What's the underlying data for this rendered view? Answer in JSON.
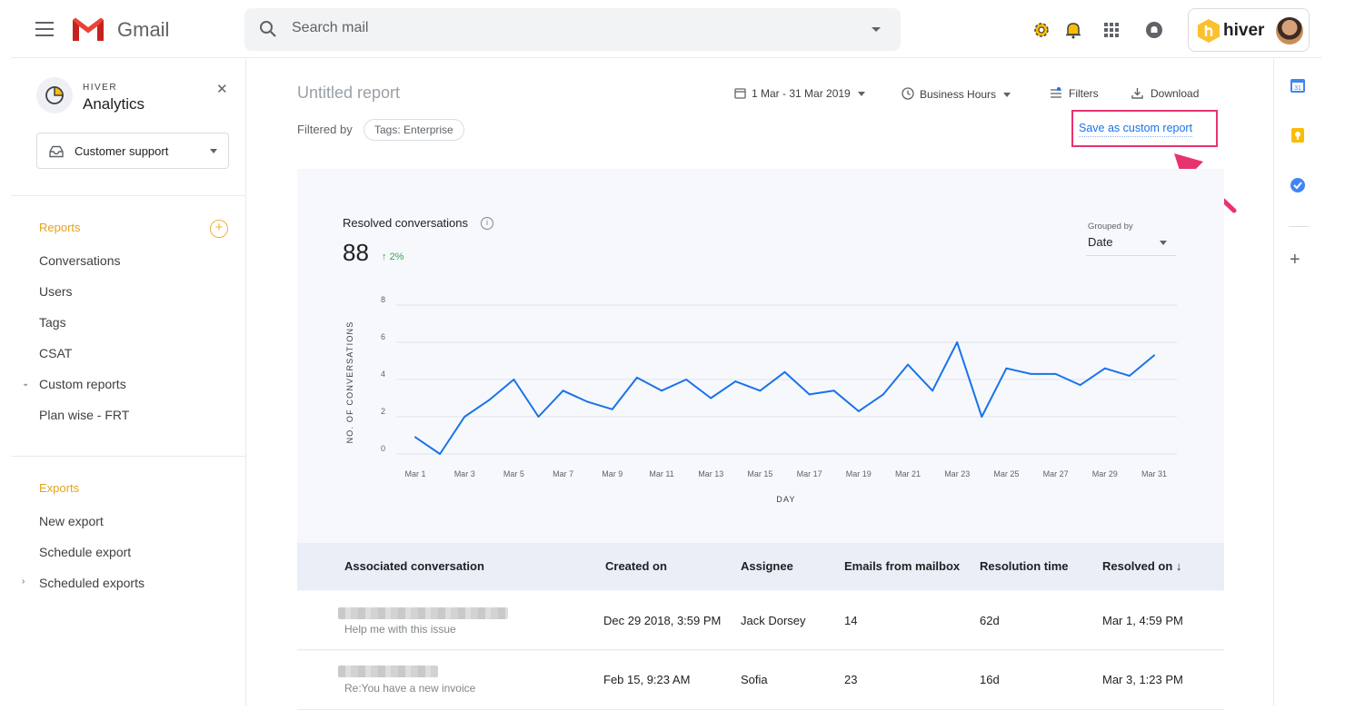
{
  "app": {
    "name": "Gmail"
  },
  "search": {
    "placeholder": "Search mail"
  },
  "hiver": {
    "label": "hiver"
  },
  "sidebar": {
    "brand_top": "HIVER",
    "brand_title": "Analytics",
    "mailbox": "Customer support",
    "reports_title": "Reports",
    "reports": [
      "Conversations",
      "Users",
      "Tags",
      "CSAT",
      "Custom reports",
      "Plan wise - FRT"
    ],
    "exports_title": "Exports",
    "exports": [
      "New export",
      "Schedule export",
      "Scheduled exports"
    ]
  },
  "report": {
    "title": "Untitled report",
    "date_range": "1 Mar - 31 Mar 2019",
    "hours": "Business Hours",
    "filters_label": "Filters",
    "download_label": "Download",
    "filtered_by": "Filtered by",
    "filter_chip": "Tags: Enterprise",
    "save_custom": "Save as custom report"
  },
  "metric": {
    "label": "Resolved conversations",
    "value": "88",
    "delta": "2%",
    "grouped_by_label": "Grouped by",
    "grouped_by_value": "Date"
  },
  "chart_data": {
    "type": "line",
    "title": "Resolved conversations",
    "xlabel": "DAY",
    "ylabel": "NO. OF CONVERSATIONS",
    "ylim": [
      0,
      8
    ],
    "yticks": [
      0,
      2,
      4,
      6,
      8
    ],
    "x": [
      "Mar 1",
      "Mar 2",
      "Mar 3",
      "Mar 4",
      "Mar 5",
      "Mar 6",
      "Mar 7",
      "Mar 8",
      "Mar 9",
      "Mar 10",
      "Mar 11",
      "Mar 12",
      "Mar 13",
      "Mar 14",
      "Mar 15",
      "Mar 16",
      "Mar 17",
      "Mar 18",
      "Mar 19",
      "Mar 20",
      "Mar 21",
      "Mar 22",
      "Mar 23",
      "Mar 24",
      "Mar 25",
      "Mar 26",
      "Mar 27",
      "Mar 28",
      "Mar 29",
      "Mar 30",
      "Mar 31"
    ],
    "xtick_labels": [
      "Mar 1",
      "Mar 3",
      "Mar 5",
      "Mar 7",
      "Mar 9",
      "Mar 11",
      "Mar 13",
      "Mar 15",
      "Mar 17",
      "Mar 19",
      "Mar 21",
      "Mar 23",
      "Mar 25",
      "Mar 27",
      "Mar 29",
      "Mar 31"
    ],
    "series": [
      {
        "values": [
          0.9,
          0,
          2,
          2.9,
          4,
          2,
          3.4,
          2.8,
          2.4,
          4.1,
          3.4,
          4,
          3,
          3.9,
          3.4,
          4.4,
          3.2,
          3.4,
          2.3,
          3.2,
          4.8,
          3.4,
          6,
          2,
          4.6,
          4.3,
          4.3,
          3.7,
          4.6,
          4.2,
          5.3
        ],
        "color": "#1a73e8"
      }
    ],
    "grid": true
  },
  "table": {
    "columns": [
      "Associated conversation",
      "Created on",
      "Assignee",
      "Emails from mailbox",
      "Resolution time",
      "Resolved on ↓"
    ],
    "rows": [
      {
        "subject": "Help me with this issue",
        "created": "Dec 29 2018, 3:59 PM",
        "assignee": "Jack Dorsey",
        "emails": "14",
        "resolution": "62d",
        "resolved": "Mar 1, 4:59 PM"
      },
      {
        "subject": "Re:You have a new invoice",
        "created": "Feb 15, 9:23 AM",
        "assignee": "Sofia",
        "emails": "23",
        "resolution": "16d",
        "resolved": "Mar 3, 1:23 PM"
      }
    ]
  },
  "colors": {
    "accent": "#1a73e8",
    "reports_orange": "#e5a21c",
    "highlight": "#e8336f",
    "positive": "#34a853"
  }
}
